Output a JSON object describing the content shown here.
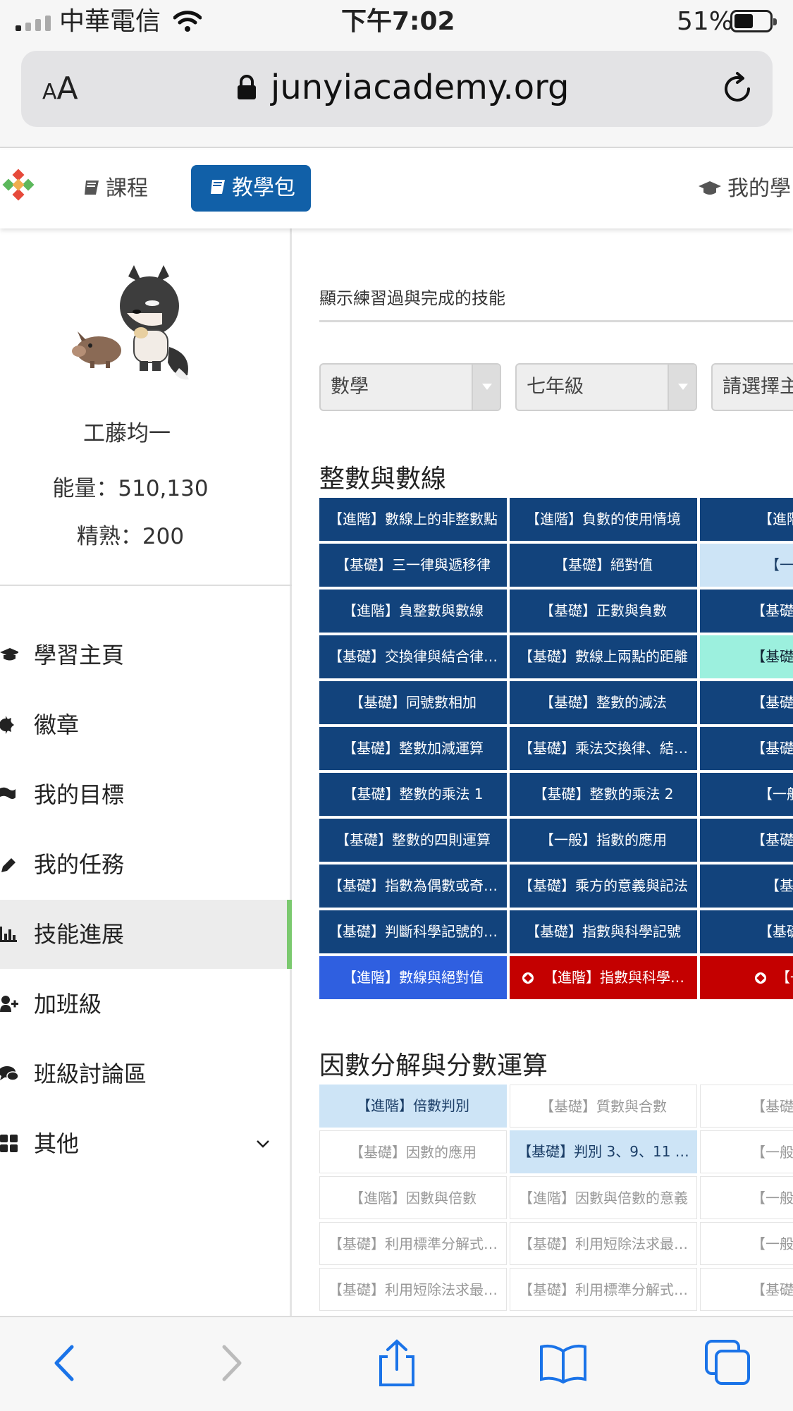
{
  "status_bar": {
    "carrier": "中華電信",
    "time": "下午7:02",
    "battery": "51%"
  },
  "browser": {
    "text_size_label": "AA",
    "url": "junyiacademy.org"
  },
  "nav": {
    "courses": "課程",
    "teaching_pack": "教學包",
    "my_learning": "我的學"
  },
  "profile": {
    "name": "工藤均一",
    "energy": "能量：510,130",
    "mastery": "精熟：200"
  },
  "menu": [
    {
      "label": "學習主頁",
      "icon": "graduation-cap-icon"
    },
    {
      "label": "徽章",
      "icon": "badge-gear-icon"
    },
    {
      "label": "我的目標",
      "icon": "flag-icon"
    },
    {
      "label": "我的任務",
      "icon": "pencil-icon"
    },
    {
      "label": "技能進展",
      "icon": "bar-chart-icon",
      "active": true
    },
    {
      "label": "加班級",
      "icon": "add-user-icon"
    },
    {
      "label": "班級討論區",
      "icon": "comments-icon"
    },
    {
      "label": "其他",
      "icon": "grid-icon"
    }
  ],
  "main": {
    "show_practiced_label": "顯示練習過與完成的技能",
    "selects": {
      "subject": "數學",
      "grade": "七年級",
      "topic": "請選擇主"
    },
    "section1": {
      "title": "整數與數線",
      "rows": [
        [
          "【進階】數線上的非整數點",
          "【進階】負數的使用情境",
          "【進階】數"
        ],
        [
          "【基礎】三一律與遞移律",
          "【基礎】絕對值",
          "【一般】"
        ],
        [
          "【進階】負整數與數線",
          "【基礎】正數與負數",
          "【基礎】數的"
        ],
        [
          "【基礎】交換律與結合律…",
          "【基礎】數線上兩點的距離",
          "【基礎】去括"
        ],
        [
          "【基礎】同號數相加",
          "【基礎】整數的減法",
          "【基礎】含絕"
        ],
        [
          "【基礎】整數加減運算",
          "【基礎】乘法交換律、結…",
          "【基礎】乘法"
        ],
        [
          "【基礎】整數的乘法 1",
          "【基礎】整數的乘法 2",
          "【一般】整"
        ],
        [
          "【基礎】整數的四則運算",
          "【一般】指數的應用",
          "【基礎】科學"
        ],
        [
          "【基礎】指數為偶數或奇…",
          "【基礎】乘方的意義與記法",
          "【基礎】"
        ],
        [
          "【基礎】判斷科學記號的…",
          "【基礎】指數與科學記號",
          "【基礎】數"
        ],
        [
          "【進階】數線與絕對值",
          "【進階】指數與科學…",
          "【一般】"
        ]
      ],
      "styles": [
        [
          "dark",
          "dark",
          "dark"
        ],
        [
          "dark",
          "dark",
          "light"
        ],
        [
          "dark",
          "dark",
          "dark"
        ],
        [
          "dark",
          "dark",
          "teal"
        ],
        [
          "dark",
          "dark",
          "dark"
        ],
        [
          "dark",
          "dark",
          "dark"
        ],
        [
          "dark",
          "dark",
          "dark"
        ],
        [
          "dark",
          "dark",
          "dark"
        ],
        [
          "dark",
          "dark",
          "dark"
        ],
        [
          "dark",
          "dark",
          "dark"
        ],
        [
          "bright",
          "red",
          "red"
        ]
      ]
    },
    "section2": {
      "title": "因數分解與分數運算",
      "rows": [
        [
          "【進階】倍數判別",
          "【基礎】質數與合數",
          "【基礎】質因"
        ],
        [
          "【基礎】因數的應用",
          "【基礎】判別 3、9、11 …",
          "【一般】質因"
        ],
        [
          "【進階】因數與倍數",
          "【進階】因數與倍數的意義",
          "【一般】最大"
        ],
        [
          "【基礎】利用標準分解式…",
          "【基礎】利用短除法求最…",
          "【一般】最小"
        ],
        [
          "【基礎】利用短除法求最…",
          "【基礎】利用標準分解式…",
          "【基礎】公因"
        ]
      ],
      "styles": [
        [
          "light",
          "white",
          "white"
        ],
        [
          "white",
          "light",
          "white"
        ],
        [
          "white",
          "white",
          "white"
        ],
        [
          "white",
          "white",
          "white"
        ],
        [
          "white",
          "white",
          "white"
        ]
      ]
    }
  },
  "toolbar": [
    "back-icon",
    "forward-icon",
    "share-icon",
    "bookmarks-icon",
    "tabs-icon"
  ]
}
